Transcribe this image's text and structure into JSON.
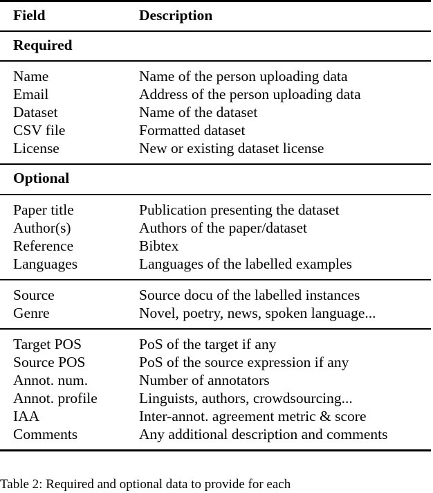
{
  "table": {
    "columns": [
      "Field",
      "Description"
    ],
    "sections": [
      {
        "label": "Required",
        "groups": [
          {
            "rows": [
              {
                "field": "Name",
                "description": "Name of the person uploading data"
              },
              {
                "field": "Email",
                "description": "Address of the person uploading data"
              },
              {
                "field": "Dataset",
                "description": "Name of the dataset"
              },
              {
                "field": "CSV file",
                "description": "Formatted dataset"
              },
              {
                "field": "License",
                "description": "New or existing dataset license"
              }
            ]
          }
        ]
      },
      {
        "label": "Optional",
        "groups": [
          {
            "rows": [
              {
                "field": "Paper title",
                "description": "Publication presenting the dataset"
              },
              {
                "field": "Author(s)",
                "description": "Authors of the paper/dataset"
              },
              {
                "field": "Reference",
                "description": "Bibtex"
              },
              {
                "field": "Languages",
                "description": "Languages of the labelled examples"
              }
            ]
          },
          {
            "rows": [
              {
                "field": "Source",
                "description": "Source docu of the labelled instances"
              },
              {
                "field": "Genre",
                "description": "Novel, poetry, news, spoken language..."
              }
            ]
          },
          {
            "rows": [
              {
                "field": "Target POS",
                "description": "PoS of the target if any"
              },
              {
                "field": "Source POS",
                "description": "PoS of the source expression if any"
              },
              {
                "field": "Annot. num.",
                "description": "Number of annotators"
              },
              {
                "field": "Annot. profile",
                "description": "Linguists, authors, crowdsourcing..."
              },
              {
                "field": "IAA",
                "description": "Inter-annot. agreement metric & score"
              },
              {
                "field": "Comments",
                "description": "Any additional description and comments"
              }
            ]
          }
        ]
      }
    ]
  },
  "caption": {
    "text": "Table 2: Required and optional data to provide for each"
  },
  "colors": {
    "text": "#000000",
    "rule": "#000000",
    "background": "#ffffff"
  }
}
